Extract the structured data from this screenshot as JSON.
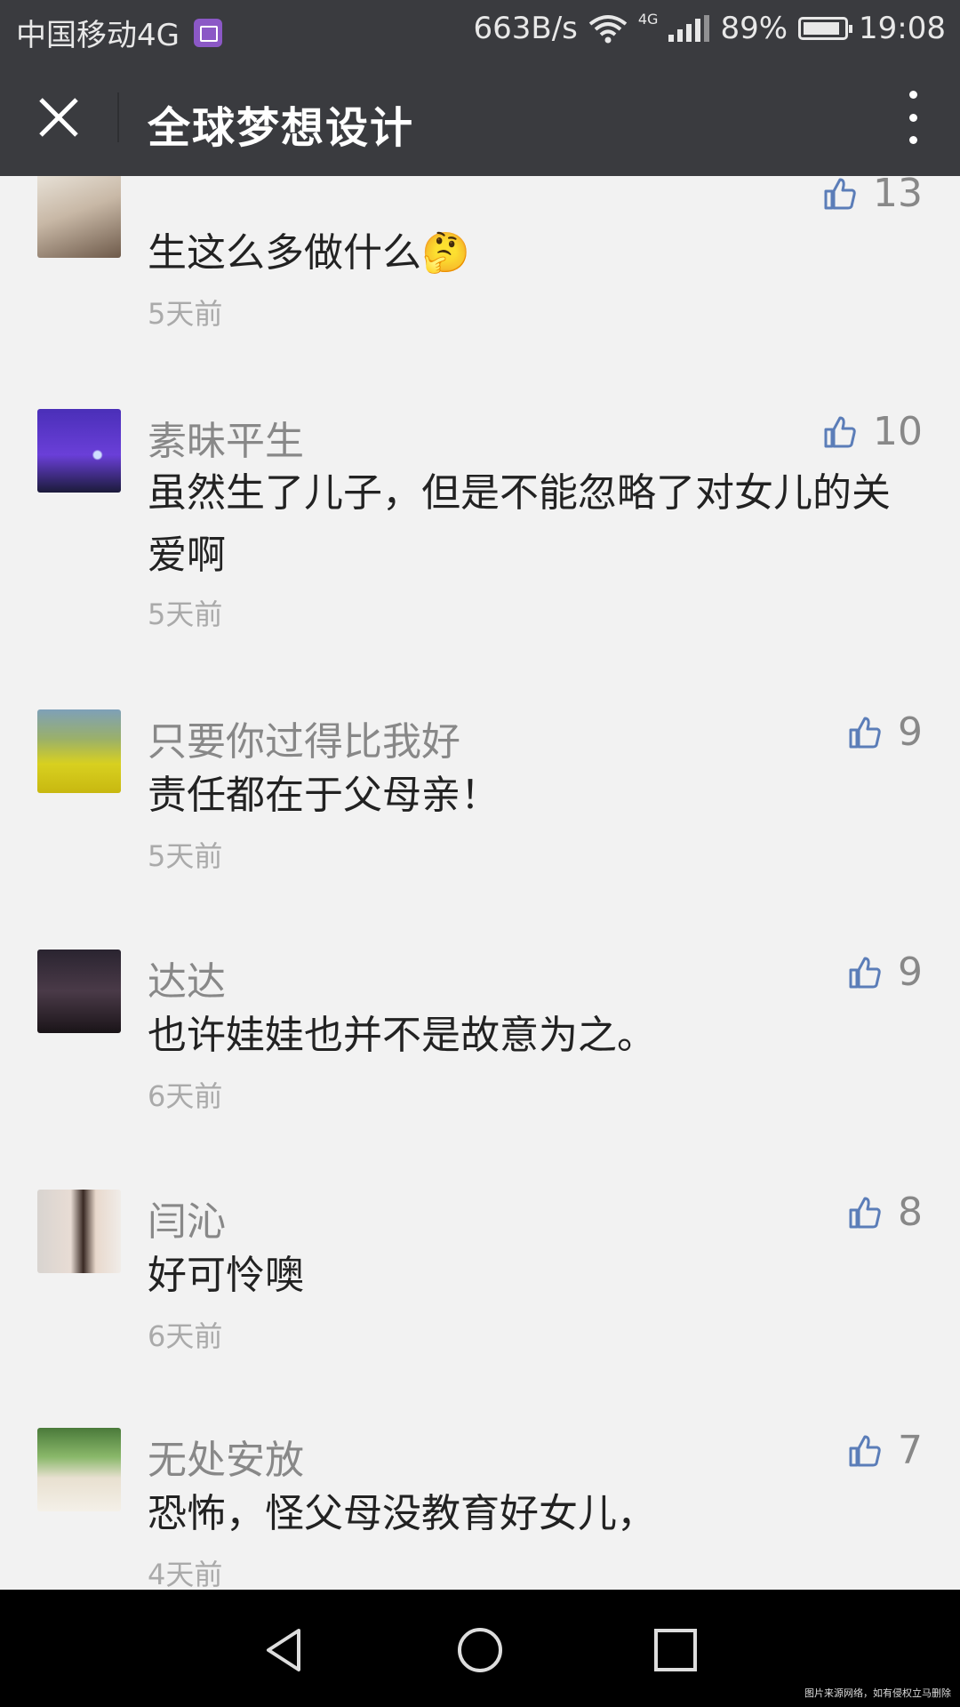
{
  "status_bar": {
    "carrier": "中国移动4G",
    "net_speed": "663B/s",
    "net_type": "4G",
    "battery": "89%",
    "time": "19:08"
  },
  "header": {
    "title": "全球梦想设计",
    "close_icon": "close-icon",
    "more_icon": "more-vertical-icon"
  },
  "comments": [
    {
      "name": "",
      "likes": "13",
      "text": "生这么多做什么🤔",
      "time": "5天前"
    },
    {
      "name": "素昧平生",
      "likes": "10",
      "text": "虽然生了儿子，但是不能忽略了对女儿的关爱啊",
      "time": "5天前"
    },
    {
      "name": "只要你过得比我好",
      "likes": "9",
      "text": "责任都在于父母亲！",
      "time": "5天前"
    },
    {
      "name": "达达",
      "likes": "9",
      "text": "也许娃娃也并不是故意为之。",
      "time": "6天前"
    },
    {
      "name": "闫沁",
      "likes": "8",
      "text": "好可怜噢",
      "time": "6天前"
    },
    {
      "name": "无处安放",
      "likes": "7",
      "text": "恐怖，怪父母没教育好女儿，",
      "time": "4天前"
    }
  ],
  "nav": {
    "back": "back-icon",
    "home": "home-icon",
    "recents": "recents-icon"
  },
  "watermark": "图片来源网络，如有侵权立马删除",
  "colors": {
    "bar": "#3a3b3f",
    "background": "#f2f2f2",
    "like_icon": "#5b7db8"
  }
}
